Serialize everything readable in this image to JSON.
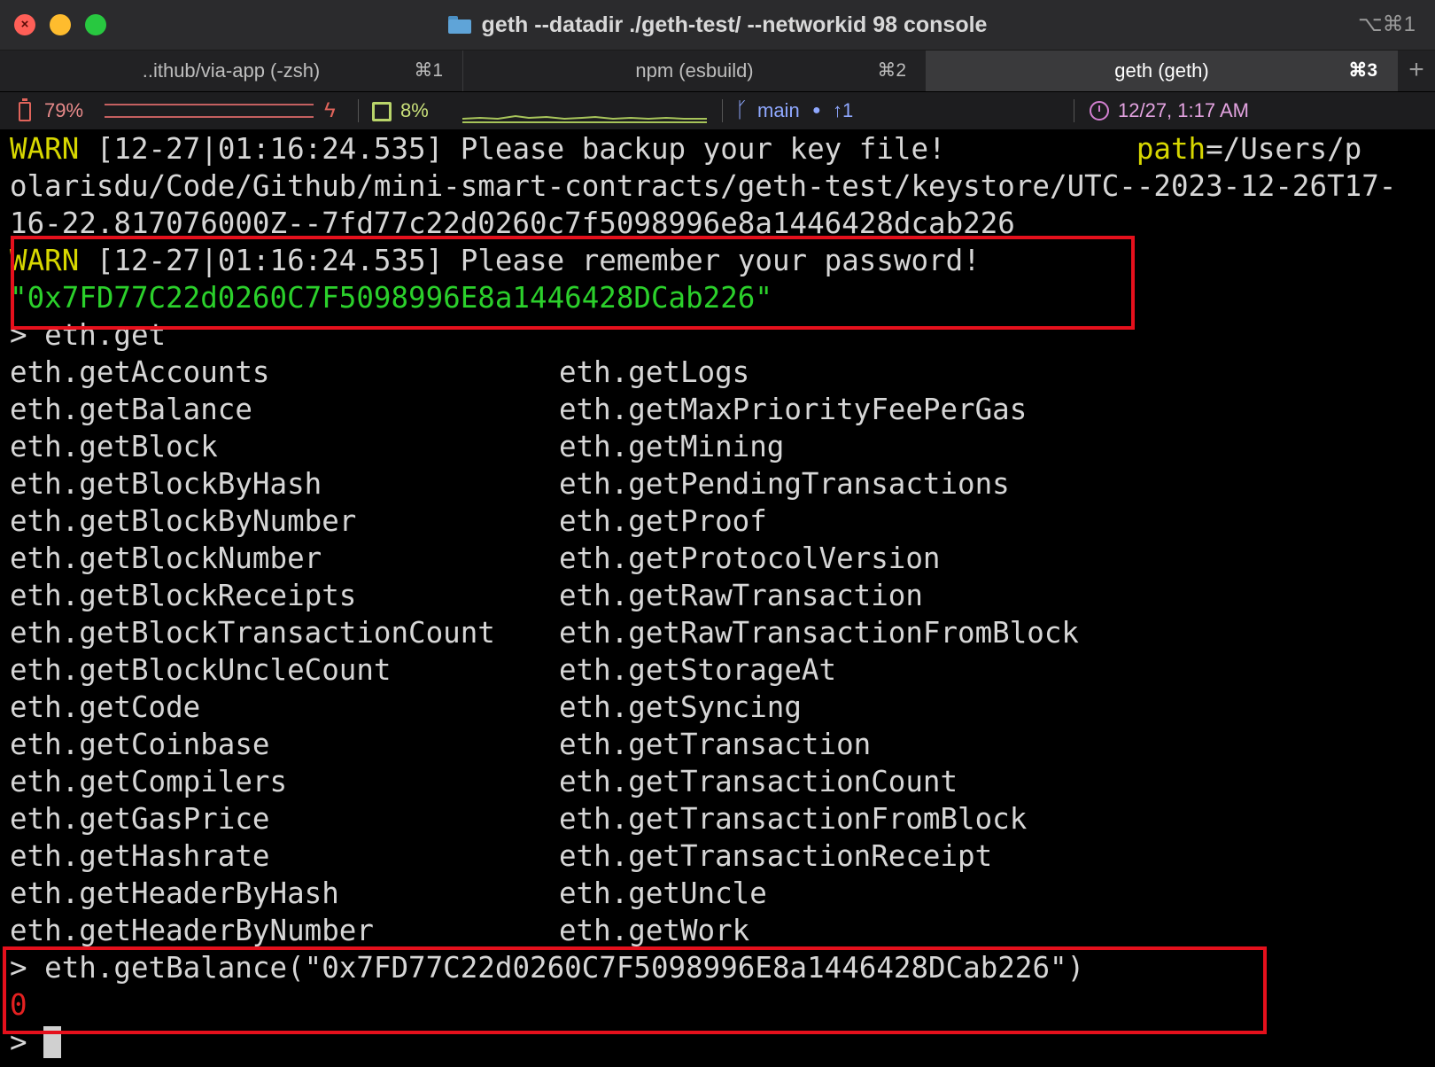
{
  "window": {
    "title": "geth --datadir ./geth-test/ --networkid 98 console",
    "shortcut": "⌥⌘1"
  },
  "tabs": [
    {
      "label": "..ithub/via-app (-zsh)",
      "key": "⌘1"
    },
    {
      "label": "npm (esbuild)",
      "key": "⌘2"
    },
    {
      "label": "geth (geth)",
      "key": "⌘3"
    }
  ],
  "tab_add": "+",
  "status": {
    "battery": "79%",
    "battery_fraction": 0.79,
    "cpu": "8%",
    "git_branch": "main",
    "git_dot": "●",
    "git_ahead": "↑1",
    "datetime": "12/27, 1:17 AM"
  },
  "terminal": {
    "warn1": {
      "level": "WARN",
      "message": " [12-27|01:16:24.535] Please backup your key file!           ",
      "path_key": "path",
      "path_value_start": "=/Users/p",
      "cont1": "olarisdu/Code/Github/mini-smart-contracts/geth-test/keystore/UTC--2023-12-26T17-",
      "cont2": "16-22.817076000Z--7fd77c22d0260c7f5098996e8a1446428dcab226"
    },
    "warn2": {
      "level": "WARN",
      "message": " [12-27|01:16:24.535] Please remember your password!"
    },
    "address_output": "\"0x7FD77C22d0260C7F5098996E8a1446428DCab226\"",
    "prompt": ">",
    "command1": " eth.get",
    "completions_left": [
      "eth.getAccounts",
      "eth.getBalance",
      "eth.getBlock",
      "eth.getBlockByHash",
      "eth.getBlockByNumber",
      "eth.getBlockNumber",
      "eth.getBlockReceipts",
      "eth.getBlockTransactionCount",
      "eth.getBlockUncleCount",
      "eth.getCode",
      "eth.getCoinbase",
      "eth.getCompilers",
      "eth.getGasPrice",
      "eth.getHashrate",
      "eth.getHeaderByHash",
      "eth.getHeaderByNumber"
    ],
    "completions_right": [
      "eth.getLogs",
      "eth.getMaxPriorityFeePerGas",
      "eth.getMining",
      "eth.getPendingTransactions",
      "eth.getProof",
      "eth.getProtocolVersion",
      "eth.getRawTransaction",
      "eth.getRawTransactionFromBlock",
      "eth.getStorageAt",
      "eth.getSyncing",
      "eth.getTransaction",
      "eth.getTransactionCount",
      "eth.getTransactionFromBlock",
      "eth.getTransactionReceipt",
      "eth.getUncle",
      "eth.getWork"
    ],
    "command2": " eth.getBalance(\"0x7FD77C22d0260C7F5098996E8a1446428DCab226\")",
    "balance_result": "0"
  },
  "colors": {
    "warn": "#d7d700",
    "address": "#2bd02b",
    "result": "#e32121",
    "highlight_box": "#e5101c"
  }
}
